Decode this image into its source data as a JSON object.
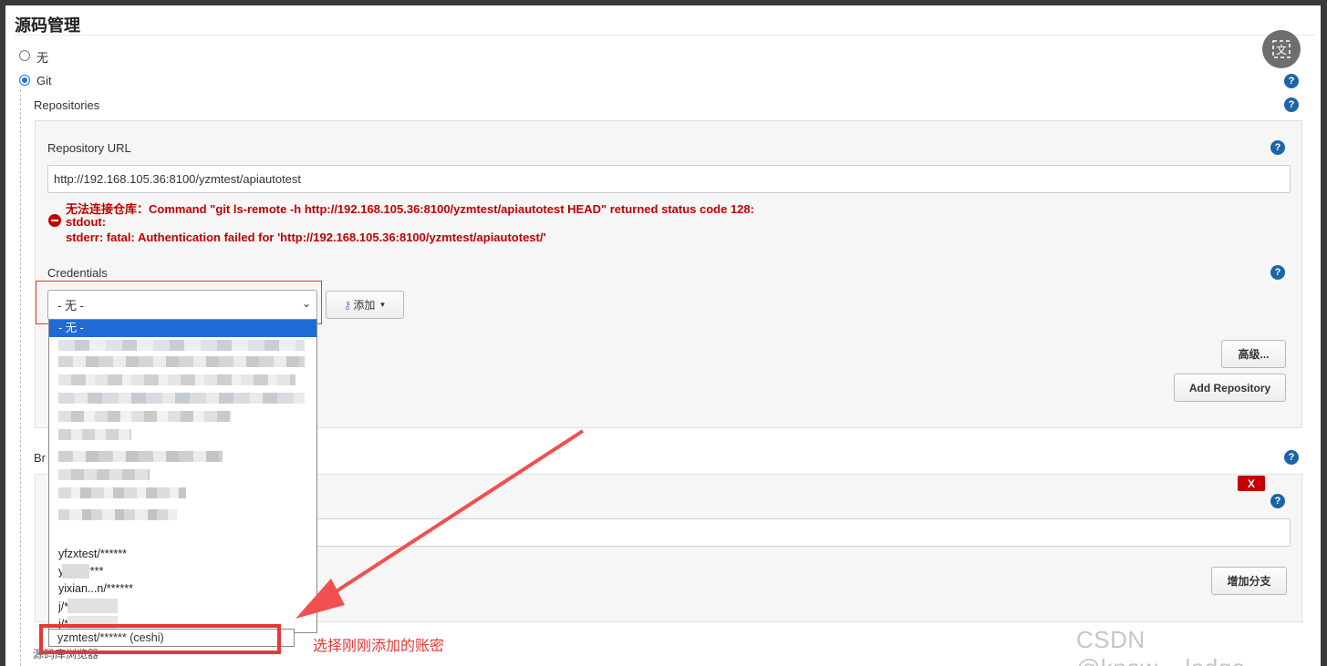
{
  "section": {
    "title": "源码管理"
  },
  "scm_options": [
    {
      "label": "无",
      "checked": false
    },
    {
      "label": "Git",
      "checked": true
    }
  ],
  "repositories": {
    "label": "Repositories",
    "url_label": "Repository URL",
    "url_value": "http://192.168.105.36:8100/yzmtest/apiautotest",
    "error_lines": [
      "无法连接仓库：Command \"git ls-remote -h http://192.168.105.36:8100/yzmtest/apiautotest HEAD\" returned status code 128:",
      "stdout:",
      "stderr: fatal: Authentication failed for 'http://192.168.105.36:8100/yzmtest/apiautotest/'"
    ],
    "credentials_label": "Credentials",
    "credentials_selected": "- 无 -",
    "add_button": "添加",
    "advanced_button": "高级...",
    "add_repository_button": "Add Repository"
  },
  "branches": {
    "label_partial": "Br",
    "delete_button": "X",
    "add_branch_button": "增加分支"
  },
  "dropdown": {
    "options": [
      "- 无 -",
      "yfzxtest/******",
      "y        n/******",
      "yixian...n/******",
      "            j/******",
      "            j/******",
      "yzmtest/****** (ceshi)"
    ]
  },
  "annotation": {
    "text": "选择刚刚添加的账密",
    "color": "#e53935"
  },
  "bottom_partial": "源码库浏览器",
  "watermark": "CSDN @know__ledge",
  "translate_icon": "translate-icon",
  "help_icon": "help-icon"
}
